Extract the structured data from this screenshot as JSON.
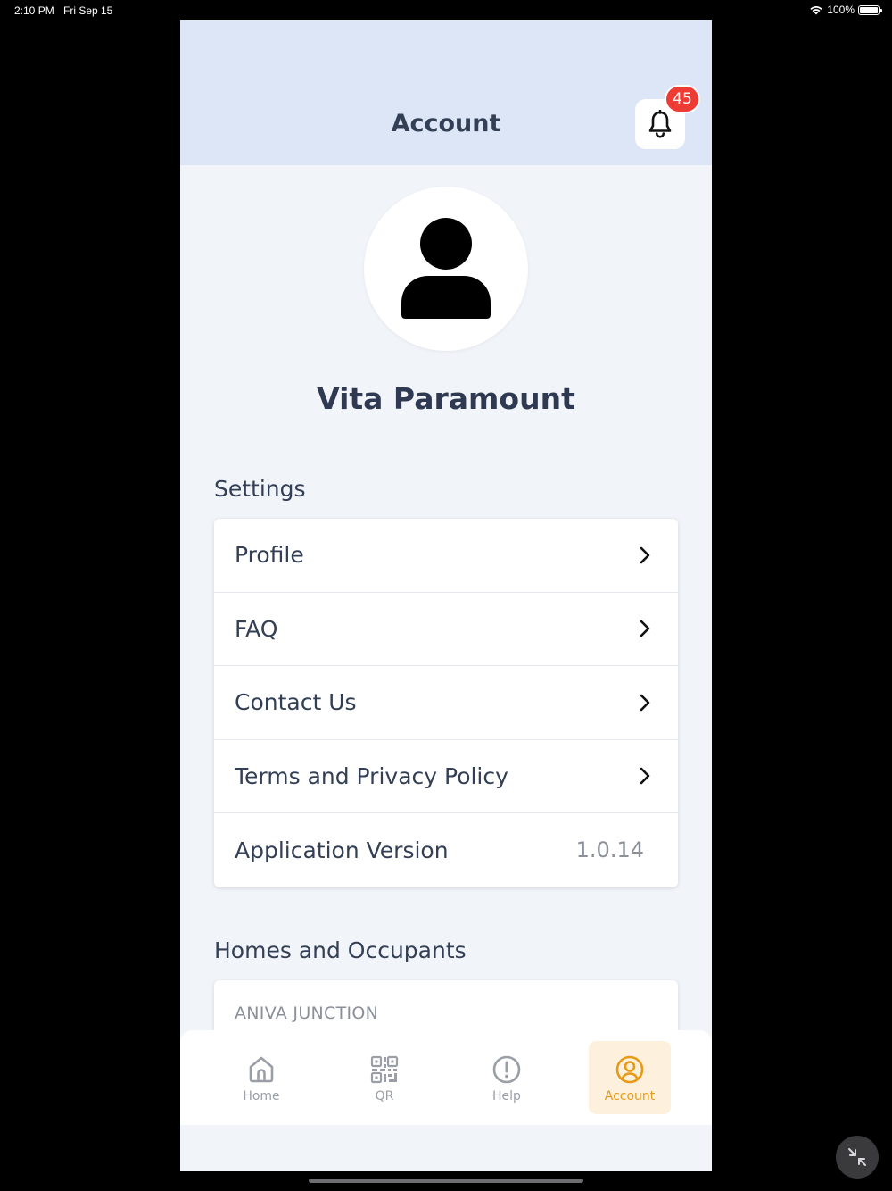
{
  "status_bar": {
    "time": "2:10 PM",
    "date": "Fri Sep 15",
    "battery": "100%"
  },
  "header": {
    "title": "Account",
    "notification_count": "45"
  },
  "user": {
    "name": "Vita Paramount"
  },
  "settings": {
    "title": "Settings",
    "items": [
      {
        "label": "Profile"
      },
      {
        "label": "FAQ"
      },
      {
        "label": "Contact Us"
      },
      {
        "label": "Terms and Privacy Policy"
      }
    ],
    "version": {
      "label": "Application Version",
      "value": "1.0.14"
    }
  },
  "homes": {
    "title": "Homes and Occupants",
    "items": [
      {
        "label": "ANIVA JUNCTION"
      }
    ]
  },
  "tabbar": {
    "tabs": [
      {
        "label": "Home",
        "icon": "home-icon"
      },
      {
        "label": "QR",
        "icon": "qr-icon"
      },
      {
        "label": "Help",
        "icon": "alert-circle-icon"
      },
      {
        "label": "Account",
        "icon": "user-circle-icon"
      }
    ],
    "active": "Account"
  },
  "colors": {
    "header_bg": "#dce6f6",
    "page_bg": "#f1f5fa",
    "accent": "#e89a16",
    "badge": "#ee3c34",
    "text": "#333f55"
  }
}
